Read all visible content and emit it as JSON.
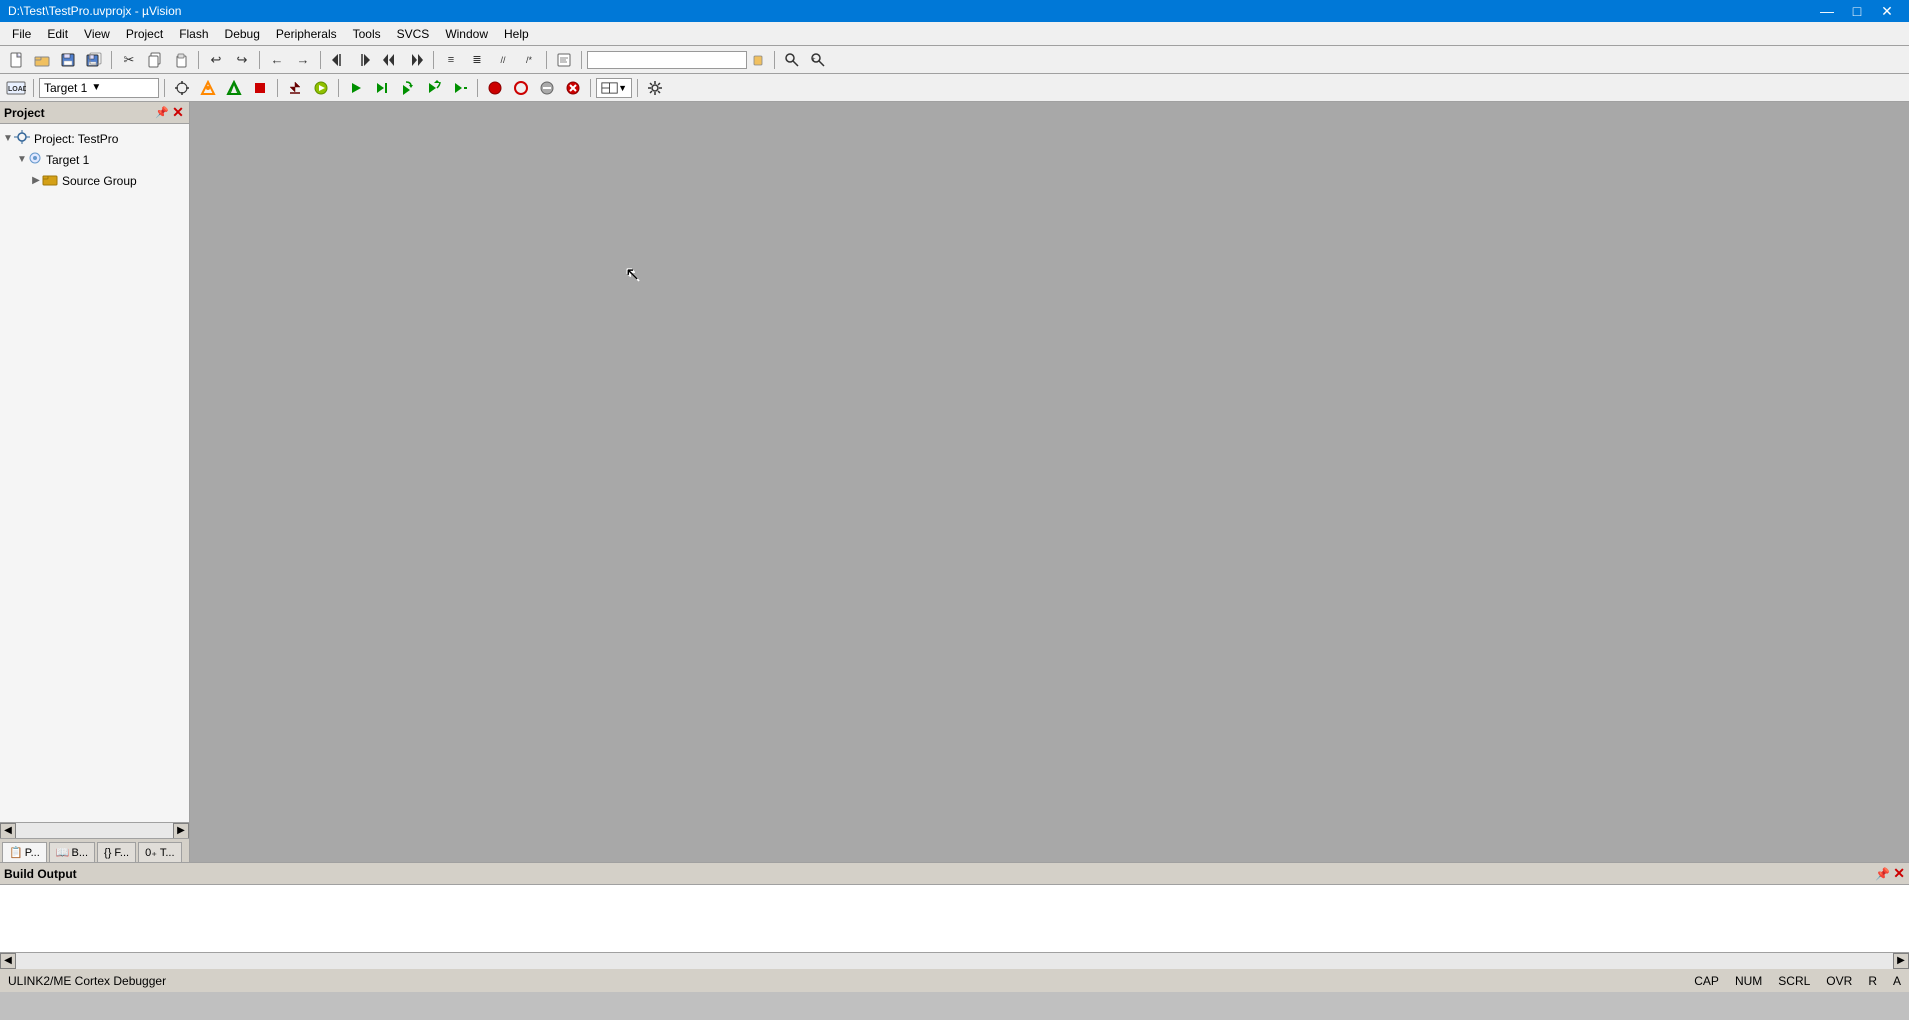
{
  "titleBar": {
    "title": "D:\\Test\\TestPro.uvprojx - µVision",
    "minimizeLabel": "minimize",
    "maximizeLabel": "maximize",
    "closeLabel": "close"
  },
  "menuBar": {
    "items": [
      {
        "label": "File",
        "id": "file"
      },
      {
        "label": "Edit",
        "id": "edit"
      },
      {
        "label": "View",
        "id": "view"
      },
      {
        "label": "Project",
        "id": "project"
      },
      {
        "label": "Flash",
        "id": "flash"
      },
      {
        "label": "Debug",
        "id": "debug"
      },
      {
        "label": "Peripherals",
        "id": "peripherals"
      },
      {
        "label": "Tools",
        "id": "tools"
      },
      {
        "label": "SVCS",
        "id": "svcs"
      },
      {
        "label": "Window",
        "id": "window"
      },
      {
        "label": "Help",
        "id": "help"
      }
    ]
  },
  "toolbar1": {
    "buttons": [
      {
        "id": "new",
        "icon": "📄",
        "title": "New"
      },
      {
        "id": "open",
        "icon": "📂",
        "title": "Open"
      },
      {
        "id": "save",
        "icon": "💾",
        "title": "Save"
      },
      {
        "id": "save-all",
        "icon": "🗄",
        "title": "Save All"
      },
      {
        "id": "cut",
        "icon": "✂",
        "title": "Cut"
      },
      {
        "id": "copy",
        "icon": "📋",
        "title": "Copy"
      },
      {
        "id": "paste",
        "icon": "📌",
        "title": "Paste"
      },
      {
        "id": "undo",
        "icon": "↩",
        "title": "Undo"
      },
      {
        "id": "redo",
        "icon": "↪",
        "title": "Redo"
      },
      {
        "id": "back",
        "icon": "←",
        "title": "Back"
      },
      {
        "id": "forward",
        "icon": "→",
        "title": "Forward"
      },
      {
        "id": "bookmark-prev",
        "icon": "◀",
        "title": "Prev Bookmark"
      },
      {
        "id": "bookmark-next",
        "icon": "▶",
        "title": "Next Bookmark"
      },
      {
        "id": "bookmark-clear",
        "icon": "◼",
        "title": "Clear Bookmark"
      },
      {
        "id": "indent",
        "icon": "≡",
        "title": "Indent"
      },
      {
        "id": "unindent",
        "icon": "≣",
        "title": "Unindent"
      },
      {
        "id": "comment",
        "icon": "//",
        "title": "Comment"
      },
      {
        "id": "uncomment",
        "icon": "×",
        "title": "Uncomment"
      },
      {
        "id": "templates",
        "icon": "📑",
        "title": "Insert Templates"
      },
      {
        "id": "search-box",
        "icon": "",
        "title": "Search"
      }
    ],
    "searchPlaceholder": ""
  },
  "toolbar2": {
    "targetName": "Target 1",
    "buttons": [
      {
        "id": "build",
        "icon": "🔨",
        "title": "Build",
        "color": "#333"
      },
      {
        "id": "rebuild",
        "icon": "⚙",
        "title": "Rebuild"
      },
      {
        "id": "stop-build",
        "icon": "⬛",
        "title": "Stop Build"
      },
      {
        "id": "download",
        "icon": "⬇",
        "title": "Download"
      },
      {
        "id": "debug-start",
        "icon": "▶",
        "title": "Start Debug"
      },
      {
        "id": "run",
        "icon": "▶▶",
        "title": "Run"
      },
      {
        "id": "step",
        "icon": "↓",
        "title": "Step"
      },
      {
        "id": "step-over",
        "icon": "⤵",
        "title": "Step Over"
      },
      {
        "id": "step-out",
        "icon": "⤴",
        "title": "Step Out"
      },
      {
        "id": "run-to-cursor",
        "icon": "↘",
        "title": "Run to Cursor"
      },
      {
        "id": "breakpoint",
        "icon": "●",
        "title": "Insert Breakpoint"
      },
      {
        "id": "enable-disable-bp",
        "icon": "○",
        "title": "Enable/Disable Breakpoint"
      },
      {
        "id": "clear-all-bp",
        "icon": "✕",
        "title": "Clear All Breakpoints"
      },
      {
        "id": "disable-all-bp",
        "icon": "◎",
        "title": "Disable All Breakpoints"
      },
      {
        "id": "logic-analyzer",
        "icon": "📊",
        "title": "Logic Analyzer"
      },
      {
        "id": "setup",
        "icon": "🔧",
        "title": "Setup"
      }
    ]
  },
  "projectPanel": {
    "title": "Project",
    "pinIcon": "📌",
    "closeIcon": "✕",
    "tree": {
      "projectNode": {
        "icon": "🌳",
        "label": "Project: TestPro",
        "expanded": true
      },
      "targetNode": {
        "icon": "🎯",
        "label": "Target 1",
        "expanded": true
      },
      "sourceGroupNode": {
        "icon": "📁",
        "label": "Source Group",
        "expanded": false
      }
    },
    "tabs": [
      {
        "id": "proj",
        "label": "P...",
        "active": true
      },
      {
        "id": "books",
        "label": "B..."
      },
      {
        "id": "funcs",
        "label": "{}F..."
      },
      {
        "id": "templates",
        "label": "0₊T..."
      }
    ]
  },
  "buildOutput": {
    "title": "Build Output",
    "pinIcon": "📌",
    "closeIcon": "✕",
    "content": ""
  },
  "statusBar": {
    "debuggerLabel": "ULINK2/ME Cortex Debugger",
    "capsLabel": "CAP",
    "numLabel": "NUM",
    "scrollLabel": "SCRL",
    "ovrLabel": "OVR",
    "rLabel": "R",
    "aLabel": "A"
  },
  "colors": {
    "background": "#a8a8a8",
    "panelBg": "#f5f5f5",
    "headerBg": "#d4d0c8",
    "titleBg": "#000080",
    "menuBg": "#f0f0f0",
    "accentBlue": "#0078d7"
  }
}
